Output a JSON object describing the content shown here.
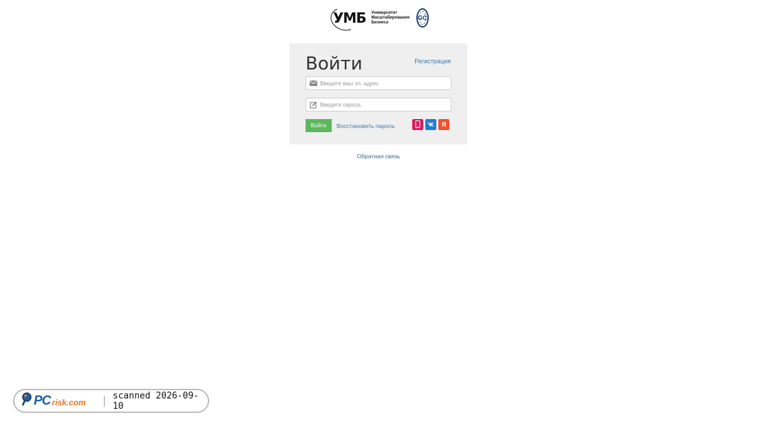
{
  "header": {
    "logo_abbr": "УМБ",
    "logo_line1": "Университет",
    "logo_line2": "Масштабирования",
    "logo_line3": "Бизнеса",
    "badge_text": "GC"
  },
  "login": {
    "title": "Войти",
    "register_label": "Регистрация",
    "email_placeholder": "Введите ваш эл. адрес",
    "email_value": "",
    "password_placeholder": "Введите пароль",
    "password_value": "",
    "submit_label": "Войти",
    "restore_label": "Восстановить пароль",
    "social": {
      "yandex_label": "Я"
    }
  },
  "footer": {
    "feedback_label": "Обратная связь"
  },
  "watermark": {
    "brand_pc": "PC",
    "brand_risk": "risk.com",
    "scan_text": "scanned 2026-09-10"
  },
  "colors": {
    "submit_button": "#5cb85c",
    "link": "#3d7bb0",
    "panel_bg": "#efefef",
    "phone_social": "#d81b60",
    "vk_social": "#1e7fd6",
    "yandex_social": "#f0512c"
  },
  "icons": {
    "email": "envelope-icon",
    "password": "pencil-icon",
    "phone": "phone-icon",
    "vk": "vk-icon",
    "yandex": "yandex-icon"
  }
}
